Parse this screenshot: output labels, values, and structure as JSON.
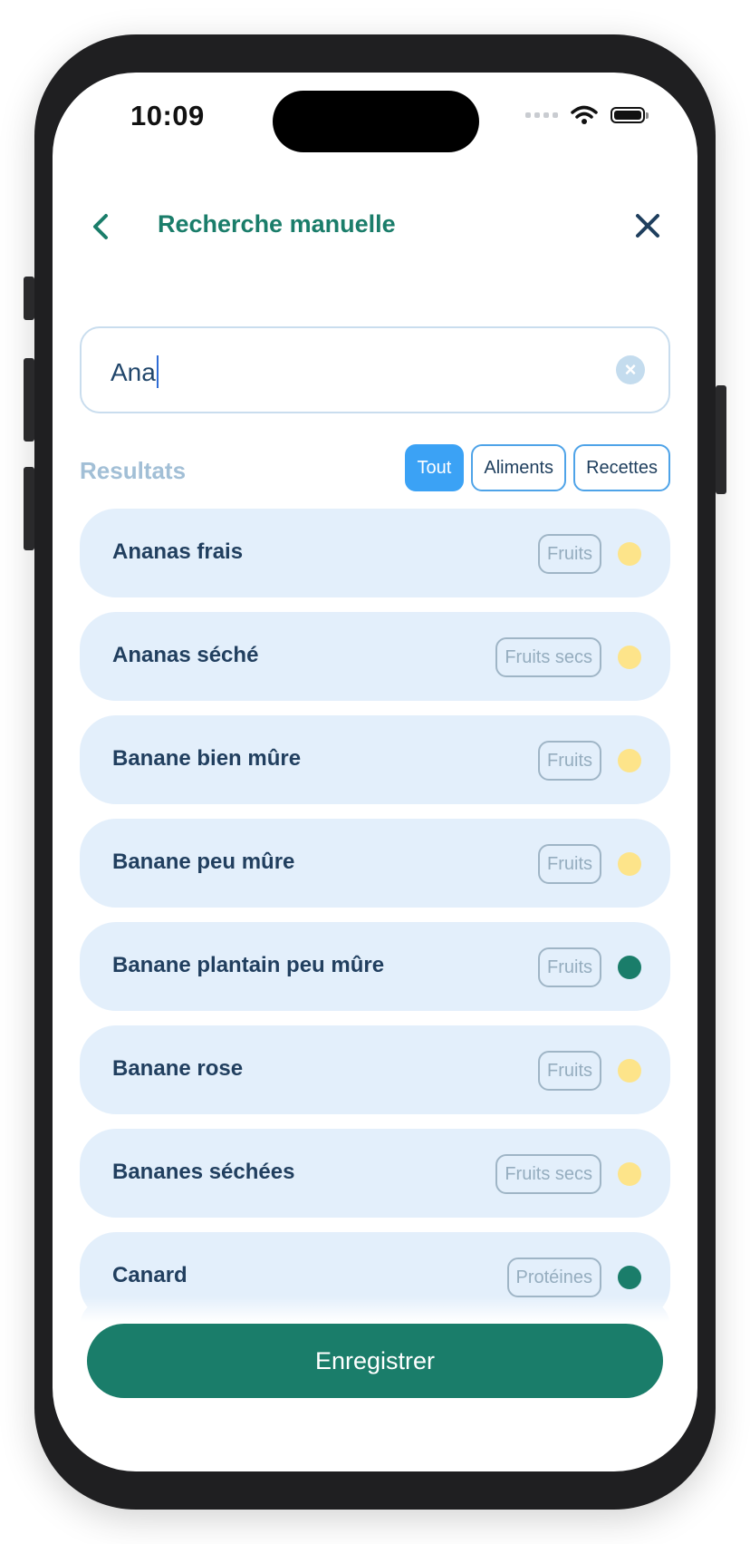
{
  "status_bar": {
    "time": "10:09"
  },
  "header": {
    "title": "Recherche manuelle",
    "back_icon": "chevron-left-icon",
    "close_icon": "close-icon"
  },
  "search": {
    "value": "Ana"
  },
  "results": {
    "label": "Resultats",
    "filters": [
      {
        "label": "Tout",
        "active": true
      },
      {
        "label": "Aliments",
        "active": false
      },
      {
        "label": "Recettes",
        "active": false
      }
    ],
    "items": [
      {
        "name": "Ananas frais",
        "category": "Fruits",
        "dot_color": "#fde48a"
      },
      {
        "name": "Ananas séché",
        "category": "Fruits secs",
        "dot_color": "#fde48a"
      },
      {
        "name": "Banane bien mûre",
        "category": "Fruits",
        "dot_color": "#fde48a"
      },
      {
        "name": "Banane peu mûre",
        "category": "Fruits",
        "dot_color": "#fde48a"
      },
      {
        "name": "Banane plantain peu mûre",
        "category": "Fruits",
        "dot_color": "#1a7d6a"
      },
      {
        "name": "Banane rose",
        "category": "Fruits",
        "dot_color": "#fde48a"
      },
      {
        "name": "Bananes séchées",
        "category": "Fruits secs",
        "dot_color": "#fde48a"
      },
      {
        "name": "Canard",
        "category": "Protéines",
        "dot_color": "#1a7d6a"
      }
    ]
  },
  "footer": {
    "save_label": "Enregistrer"
  },
  "colors": {
    "primary": "#1a7d6a",
    "accent": "#3ba2f5",
    "item_bg": "#e3effb"
  }
}
